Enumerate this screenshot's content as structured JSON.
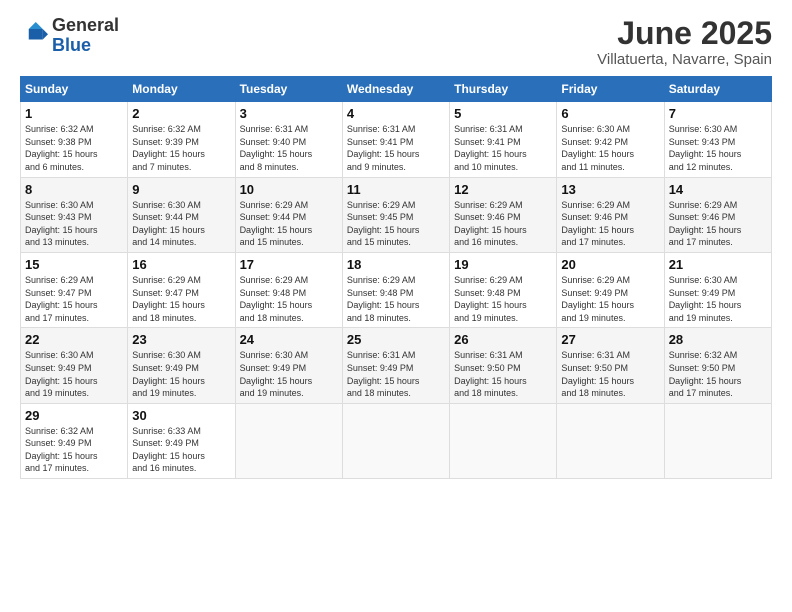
{
  "logo": {
    "general": "General",
    "blue": "Blue"
  },
  "title": {
    "main": "June 2025",
    "sub": "Villatuerta, Navarre, Spain"
  },
  "days_of_week": [
    "Sunday",
    "Monday",
    "Tuesday",
    "Wednesday",
    "Thursday",
    "Friday",
    "Saturday"
  ],
  "weeks": [
    [
      {
        "day": 1,
        "sunrise": "6:32 AM",
        "sunset": "9:38 PM",
        "daylight": "15 hours and 6 minutes."
      },
      {
        "day": 2,
        "sunrise": "6:32 AM",
        "sunset": "9:39 PM",
        "daylight": "15 hours and 7 minutes."
      },
      {
        "day": 3,
        "sunrise": "6:31 AM",
        "sunset": "9:40 PM",
        "daylight": "15 hours and 8 minutes."
      },
      {
        "day": 4,
        "sunrise": "6:31 AM",
        "sunset": "9:41 PM",
        "daylight": "15 hours and 9 minutes."
      },
      {
        "day": 5,
        "sunrise": "6:31 AM",
        "sunset": "9:41 PM",
        "daylight": "15 hours and 10 minutes."
      },
      {
        "day": 6,
        "sunrise": "6:30 AM",
        "sunset": "9:42 PM",
        "daylight": "15 hours and 11 minutes."
      },
      {
        "day": 7,
        "sunrise": "6:30 AM",
        "sunset": "9:43 PM",
        "daylight": "15 hours and 12 minutes."
      }
    ],
    [
      {
        "day": 8,
        "sunrise": "6:30 AM",
        "sunset": "9:43 PM",
        "daylight": "15 hours and 13 minutes."
      },
      {
        "day": 9,
        "sunrise": "6:30 AM",
        "sunset": "9:44 PM",
        "daylight": "15 hours and 14 minutes."
      },
      {
        "day": 10,
        "sunrise": "6:29 AM",
        "sunset": "9:44 PM",
        "daylight": "15 hours and 15 minutes."
      },
      {
        "day": 11,
        "sunrise": "6:29 AM",
        "sunset": "9:45 PM",
        "daylight": "15 hours and 15 minutes."
      },
      {
        "day": 12,
        "sunrise": "6:29 AM",
        "sunset": "9:46 PM",
        "daylight": "15 hours and 16 minutes."
      },
      {
        "day": 13,
        "sunrise": "6:29 AM",
        "sunset": "9:46 PM",
        "daylight": "15 hours and 17 minutes."
      },
      {
        "day": 14,
        "sunrise": "6:29 AM",
        "sunset": "9:46 PM",
        "daylight": "15 hours and 17 minutes."
      }
    ],
    [
      {
        "day": 15,
        "sunrise": "6:29 AM",
        "sunset": "9:47 PM",
        "daylight": "15 hours and 17 minutes."
      },
      {
        "day": 16,
        "sunrise": "6:29 AM",
        "sunset": "9:47 PM",
        "daylight": "15 hours and 18 minutes."
      },
      {
        "day": 17,
        "sunrise": "6:29 AM",
        "sunset": "9:48 PM",
        "daylight": "15 hours and 18 minutes."
      },
      {
        "day": 18,
        "sunrise": "6:29 AM",
        "sunset": "9:48 PM",
        "daylight": "15 hours and 18 minutes."
      },
      {
        "day": 19,
        "sunrise": "6:29 AM",
        "sunset": "9:48 PM",
        "daylight": "15 hours and 19 minutes."
      },
      {
        "day": 20,
        "sunrise": "6:29 AM",
        "sunset": "9:49 PM",
        "daylight": "15 hours and 19 minutes."
      },
      {
        "day": 21,
        "sunrise": "6:30 AM",
        "sunset": "9:49 PM",
        "daylight": "15 hours and 19 minutes."
      }
    ],
    [
      {
        "day": 22,
        "sunrise": "6:30 AM",
        "sunset": "9:49 PM",
        "daylight": "15 hours and 19 minutes."
      },
      {
        "day": 23,
        "sunrise": "6:30 AM",
        "sunset": "9:49 PM",
        "daylight": "15 hours and 19 minutes."
      },
      {
        "day": 24,
        "sunrise": "6:30 AM",
        "sunset": "9:49 PM",
        "daylight": "15 hours and 19 minutes."
      },
      {
        "day": 25,
        "sunrise": "6:31 AM",
        "sunset": "9:49 PM",
        "daylight": "15 hours and 18 minutes."
      },
      {
        "day": 26,
        "sunrise": "6:31 AM",
        "sunset": "9:50 PM",
        "daylight": "15 hours and 18 minutes."
      },
      {
        "day": 27,
        "sunrise": "6:31 AM",
        "sunset": "9:50 PM",
        "daylight": "15 hours and 18 minutes."
      },
      {
        "day": 28,
        "sunrise": "6:32 AM",
        "sunset": "9:50 PM",
        "daylight": "15 hours and 17 minutes."
      }
    ],
    [
      {
        "day": 29,
        "sunrise": "6:32 AM",
        "sunset": "9:49 PM",
        "daylight": "15 hours and 17 minutes."
      },
      {
        "day": 30,
        "sunrise": "6:33 AM",
        "sunset": "9:49 PM",
        "daylight": "15 hours and 16 minutes."
      },
      null,
      null,
      null,
      null,
      null
    ]
  ],
  "labels": {
    "sunrise": "Sunrise:",
    "sunset": "Sunset:",
    "daylight": "Daylight:"
  }
}
